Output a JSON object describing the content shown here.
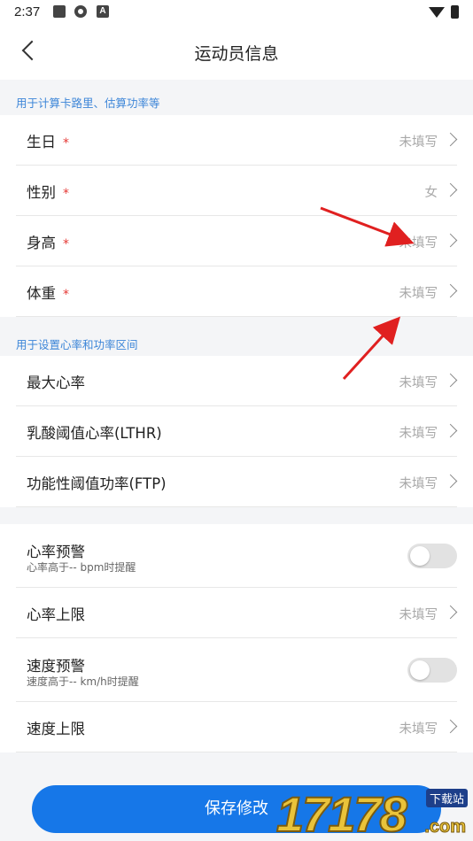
{
  "status_bar": {
    "time": "2:37",
    "a_badge": "A"
  },
  "header": {
    "title": "运动员信息"
  },
  "section1": {
    "header": "用于计算卡路里、估算功率等",
    "rows": [
      {
        "label": "生日",
        "required_mark": "*",
        "value": "未填写"
      },
      {
        "label": "性别",
        "required_mark": "*",
        "value": "女"
      },
      {
        "label": "身高",
        "required_mark": "*",
        "value": "未填写"
      },
      {
        "label": "体重",
        "required_mark": "*",
        "value": "未填写"
      }
    ]
  },
  "section2": {
    "header": "用于设置心率和功率区间",
    "rows": [
      {
        "label": "最大心率",
        "value": "未填写"
      },
      {
        "label": "乳酸阈值心率(LTHR)",
        "value": "未填写"
      },
      {
        "label": "功能性阈值功率(FTP)",
        "value": "未填写"
      }
    ]
  },
  "section3": {
    "hr_alert": {
      "label": "心率预警",
      "sub": "心率高于-- bpm时提醒",
      "enabled": false
    },
    "hr_limit": {
      "label": "心率上限",
      "value": "未填写"
    },
    "speed_alert": {
      "label": "速度预警",
      "sub": "速度高于-- km/h时提醒",
      "enabled": false
    },
    "speed_limit": {
      "label": "速度上限",
      "value": "未填写"
    }
  },
  "footer": {
    "save_label": "保存修改"
  },
  "watermark": {
    "text": "17178",
    "tag": "下载站",
    "domain": ".com"
  },
  "colors": {
    "accent": "#1677e8",
    "section_header": "#3d86d8",
    "required": "#e53935",
    "annotation_arrow": "#e02020"
  }
}
